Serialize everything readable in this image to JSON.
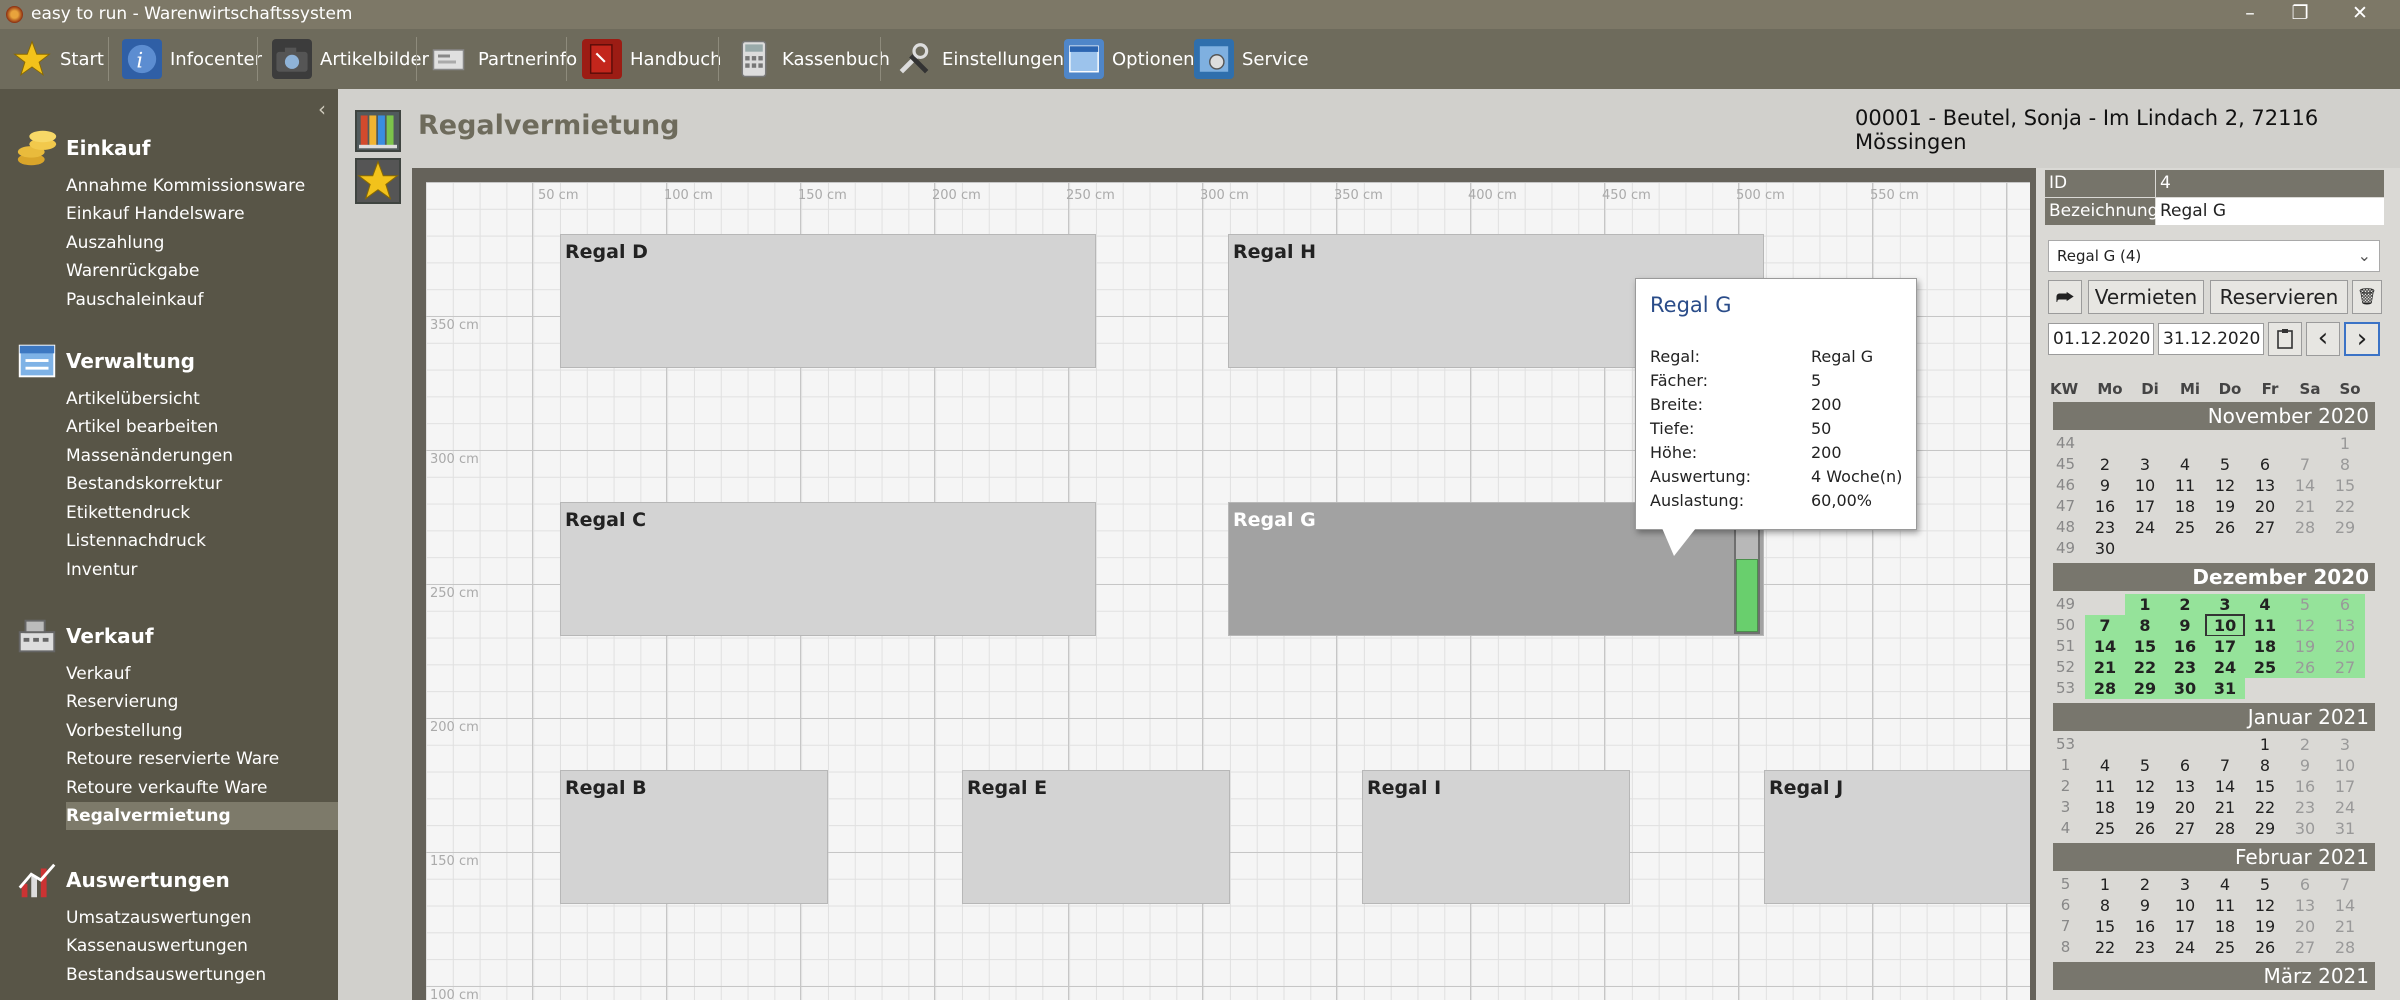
{
  "app": {
    "title": "easy to run - Warenwirtschaftssystem"
  },
  "window_controls": {
    "minimize": "–",
    "maximize": "❐",
    "close": "✕"
  },
  "toolbar": [
    {
      "name": "start",
      "label": "Start",
      "icon": "star-icon",
      "color": "#f2c21b"
    },
    {
      "name": "infocenter",
      "label": "Infocenter",
      "icon": "info-globe-icon",
      "color": "#3c6fb5"
    },
    {
      "name": "artikelbilder",
      "label": "Artikelbilder",
      "icon": "camera-icon",
      "color": "#4a4a4a"
    },
    {
      "name": "partnerinfo",
      "label": "Partnerinfo",
      "icon": "business-card-icon",
      "color": "#bdbdbd"
    },
    {
      "name": "handbuch",
      "label": "Handbuch",
      "icon": "book-icon",
      "color": "#b0221a"
    },
    {
      "name": "kassenbuch",
      "label": "Kassenbuch",
      "icon": "calculator-icon",
      "color": "#d8d8d8"
    },
    {
      "name": "einstellungen",
      "label": "Einstellungen",
      "icon": "tools-icon",
      "color": "#555"
    },
    {
      "name": "optionen",
      "label": "Optionen",
      "icon": "options-window-icon",
      "color": "#4f86c9"
    },
    {
      "name": "service",
      "label": "Service",
      "icon": "service-gear-icon",
      "color": "#3c84c5"
    }
  ],
  "sidebar": {
    "collapse": "‹",
    "sections": [
      {
        "title": "Einkauf",
        "icon": "coins-icon",
        "items": [
          "Annahme Kommissionsware",
          "Einkauf Handelsware",
          "Auszahlung",
          "Warenrückgabe",
          "Pauschaleinkauf"
        ]
      },
      {
        "title": "Verwaltung",
        "icon": "window-list-icon",
        "items": [
          "Artikelübersicht",
          "Artikel bearbeiten",
          "Massenänderungen",
          "Bestandskorrektur",
          "Etikettendruck",
          "Listennachdruck",
          "Inventur"
        ]
      },
      {
        "title": "Verkauf",
        "icon": "cash-register-icon",
        "items": [
          "Verkauf",
          "Reservierung",
          "Vorbestellung",
          "Retoure reservierte Ware",
          "Retoure verkaufte Ware",
          "Regalvermietung"
        ]
      },
      {
        "title": "Auswertungen",
        "icon": "chart-icon",
        "items": [
          "Umsatzauswertungen",
          "Kassenauswertungen",
          "Bestandsauswertungen"
        ]
      }
    ],
    "active_item": "Regalvermietung"
  },
  "page": {
    "title": "Regalvermietung",
    "customer": "00001 - Beutel, Sonja - Im Lindach 2, 72116 Mössingen"
  },
  "canvas": {
    "x_ticks": [
      "50 cm",
      "100 cm",
      "150 cm",
      "200 cm",
      "250 cm",
      "300 cm",
      "350 cm",
      "400 cm",
      "450 cm",
      "500 cm",
      "550 cm"
    ],
    "y_ticks": [
      "350 cm",
      "300 cm",
      "250 cm",
      "200 cm",
      "150 cm",
      "100 cm"
    ],
    "shelves": [
      {
        "name": "Regal D"
      },
      {
        "name": "Regal H"
      },
      {
        "name": "Regal C"
      },
      {
        "name": "Regal G",
        "selected": true,
        "auslastung": 0.6
      },
      {
        "name": "Regal B"
      },
      {
        "name": "Regal E"
      },
      {
        "name": "Regal I"
      },
      {
        "name": "Regal J"
      }
    ]
  },
  "tooltip": {
    "title": "Regal G",
    "rows": [
      {
        "label": "Regal:",
        "value": "Regal G"
      },
      {
        "label": "Fächer:",
        "value": "5"
      },
      {
        "label": "Breite:",
        "value": "200"
      },
      {
        "label": "Tiefe:",
        "value": "50"
      },
      {
        "label": "Höhe:",
        "value": "200"
      },
      {
        "label": "Auswertung:",
        "value": "4 Woche(n)"
      },
      {
        "label": "Auslastung:",
        "value": "60,00%"
      }
    ]
  },
  "props": {
    "id_label": "ID",
    "id_value": "4",
    "name_label": "Bezeichnung",
    "name_value": "Regal G"
  },
  "shelf_select": "Regal G (4)",
  "buttons": {
    "share": "⮫",
    "vermieten": "Vermieten",
    "reservieren": "Reservieren",
    "delete": "🗑"
  },
  "dates": {
    "from": "01.12.2020",
    "to": "31.12.2020",
    "prev": "‹",
    "next": "›"
  },
  "calendar": {
    "weekday_header": [
      "KW",
      "Mo",
      "Di",
      "Mi",
      "Do",
      "Fr",
      "Sa",
      "So"
    ],
    "months": [
      {
        "name": "November 2020",
        "weeks": [
          {
            "kw": "44",
            "days": [
              "",
              "",
              "",
              "",
              "",
              "",
              "1"
            ]
          },
          {
            "kw": "45",
            "days": [
              "2",
              "3",
              "4",
              "5",
              "6",
              "7",
              "8"
            ]
          },
          {
            "kw": "46",
            "days": [
              "9",
              "10",
              "11",
              "12",
              "13",
              "14",
              "15"
            ]
          },
          {
            "kw": "47",
            "days": [
              "16",
              "17",
              "18",
              "19",
              "20",
              "21",
              "22"
            ]
          },
          {
            "kw": "48",
            "days": [
              "23",
              "24",
              "25",
              "26",
              "27",
              "28",
              "29"
            ]
          },
          {
            "kw": "49",
            "days": [
              "30",
              "",
              "",
              "",
              "",
              "",
              ""
            ]
          }
        ]
      },
      {
        "name": "Dezember 2020",
        "active": true,
        "today": "10",
        "weeks": [
          {
            "kw": "49",
            "days": [
              "",
              "1",
              "2",
              "3",
              "4",
              "5",
              "6"
            ]
          },
          {
            "kw": "50",
            "days": [
              "7",
              "8",
              "9",
              "10",
              "11",
              "12",
              "13"
            ]
          },
          {
            "kw": "51",
            "days": [
              "14",
              "15",
              "16",
              "17",
              "18",
              "19",
              "20"
            ]
          },
          {
            "kw": "52",
            "days": [
              "21",
              "22",
              "23",
              "24",
              "25",
              "26",
              "27"
            ]
          },
          {
            "kw": "53",
            "days": [
              "28",
              "29",
              "30",
              "31",
              "",
              "",
              ""
            ]
          }
        ]
      },
      {
        "name": "Januar 2021",
        "weeks": [
          {
            "kw": "53",
            "days": [
              "",
              "",
              "",
              "",
              "1",
              "2",
              "3"
            ]
          },
          {
            "kw": "1",
            "days": [
              "4",
              "5",
              "6",
              "7",
              "8",
              "9",
              "10"
            ]
          },
          {
            "kw": "2",
            "days": [
              "11",
              "12",
              "13",
              "14",
              "15",
              "16",
              "17"
            ]
          },
          {
            "kw": "3",
            "days": [
              "18",
              "19",
              "20",
              "21",
              "22",
              "23",
              "24"
            ]
          },
          {
            "kw": "4",
            "days": [
              "25",
              "26",
              "27",
              "28",
              "29",
              "30",
              "31"
            ]
          }
        ]
      },
      {
        "name": "Februar 2021",
        "weeks": [
          {
            "kw": "5",
            "days": [
              "1",
              "2",
              "3",
              "4",
              "5",
              "6",
              "7"
            ]
          },
          {
            "kw": "6",
            "days": [
              "8",
              "9",
              "10",
              "11",
              "12",
              "13",
              "14"
            ]
          },
          {
            "kw": "7",
            "days": [
              "15",
              "16",
              "17",
              "18",
              "19",
              "20",
              "21"
            ]
          },
          {
            "kw": "8",
            "days": [
              "22",
              "23",
              "24",
              "25",
              "26",
              "27",
              "28"
            ]
          }
        ]
      },
      {
        "name": "März 2021",
        "weeks": []
      }
    ]
  }
}
